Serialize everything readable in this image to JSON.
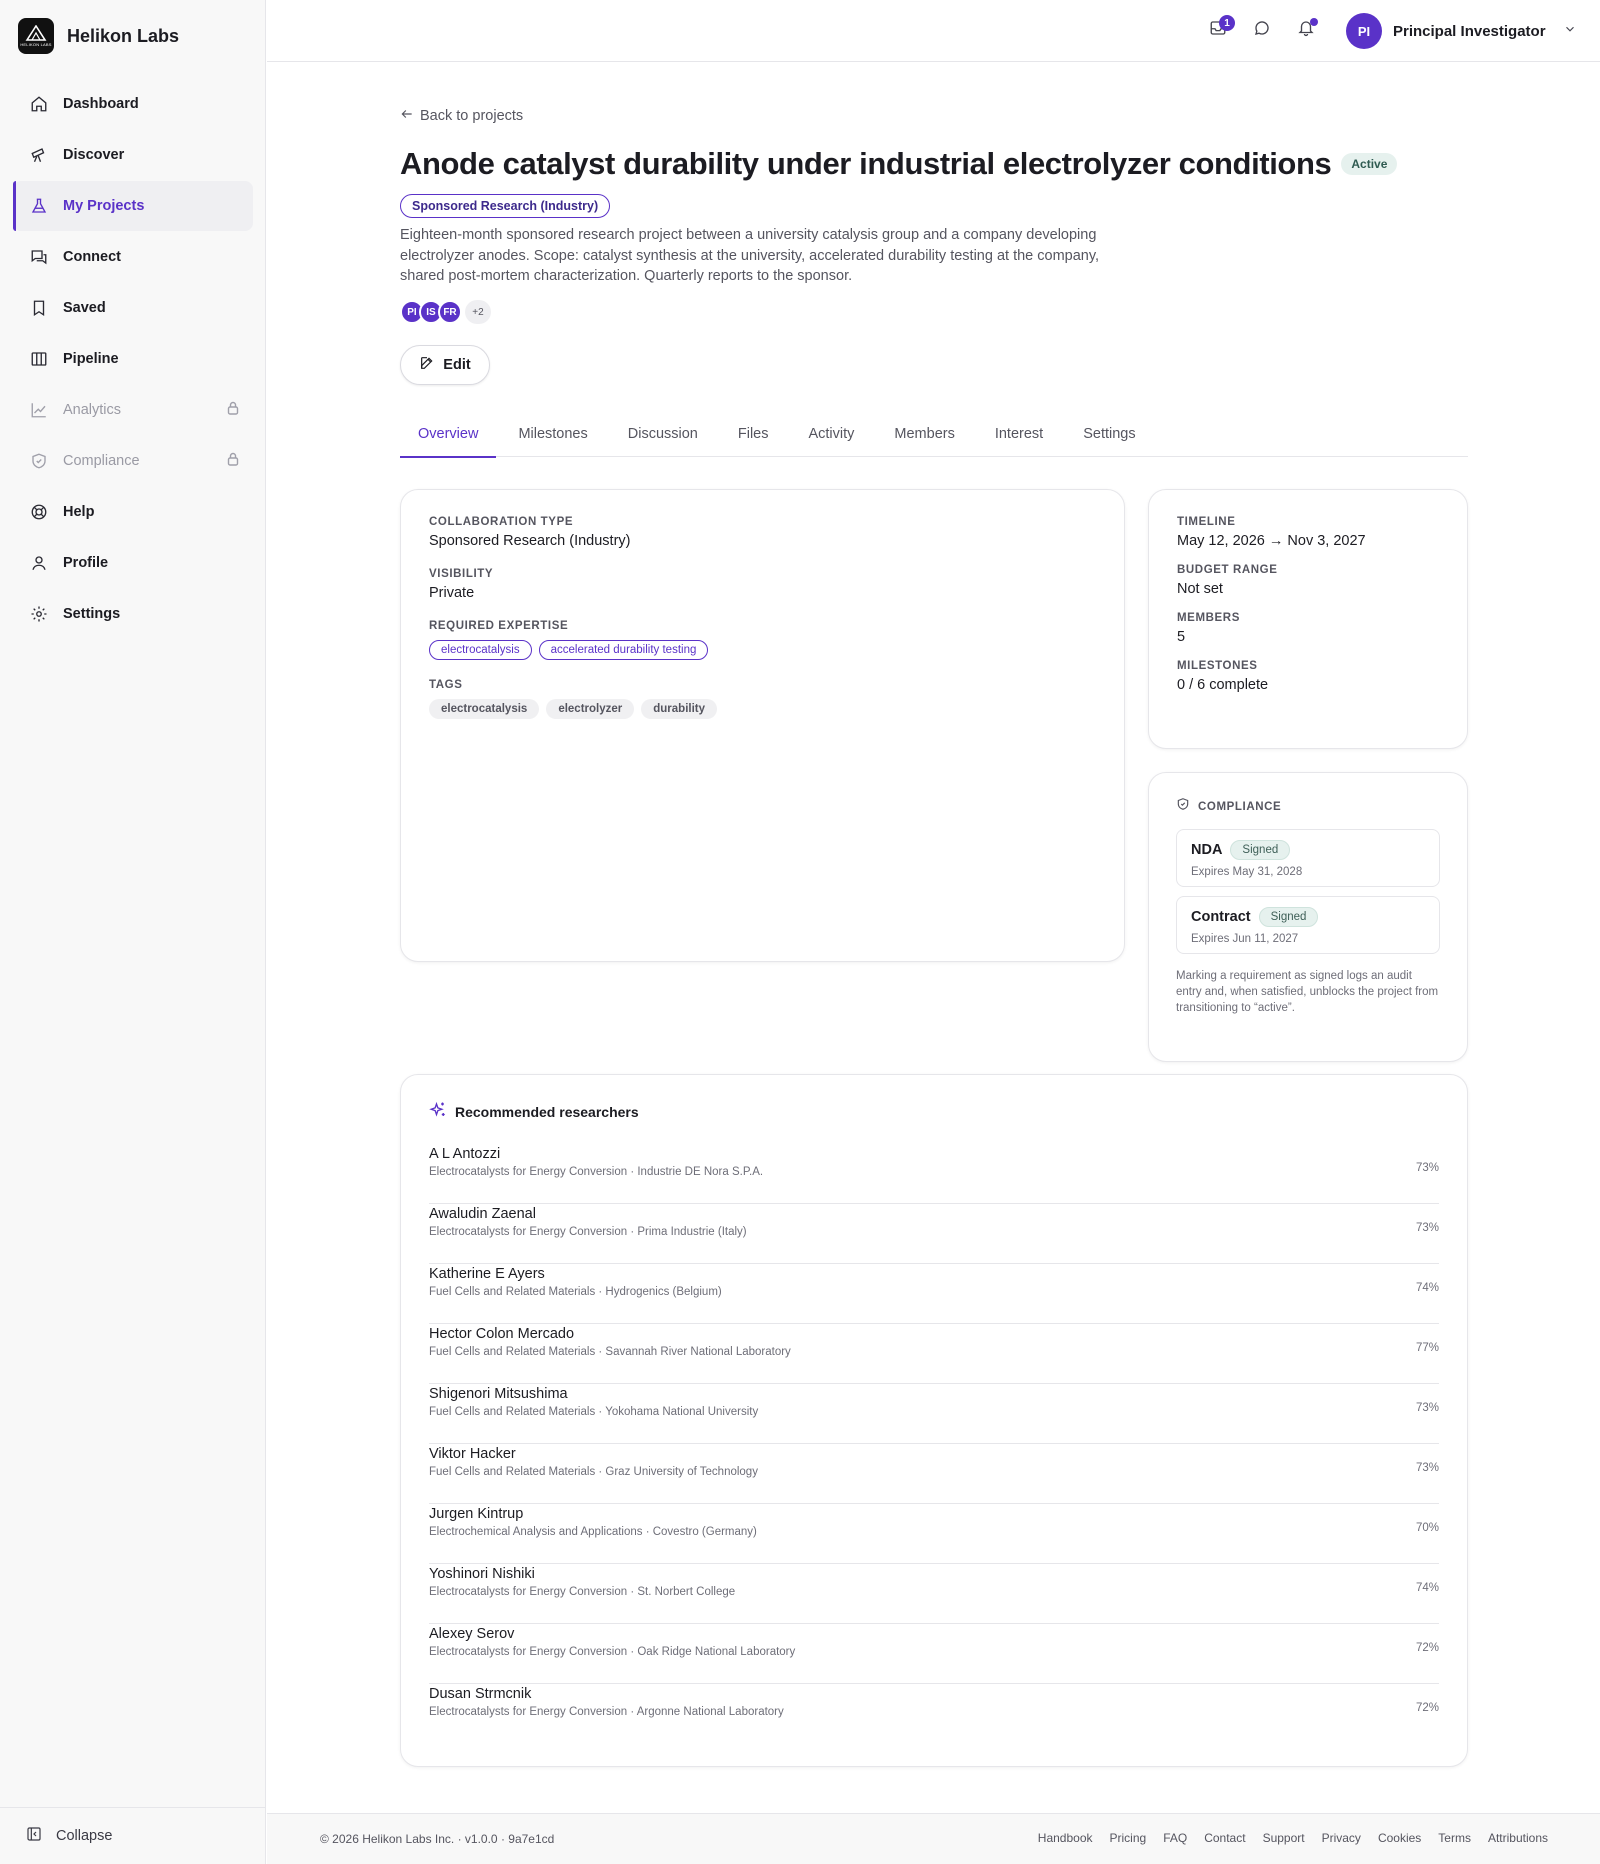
{
  "app": {
    "name": "Helikon Labs",
    "logo_text": "HELIKON LABS"
  },
  "sidebar": {
    "items": [
      {
        "label": "Dashboard",
        "icon": "home-icon",
        "state": "normal"
      },
      {
        "label": "Discover",
        "icon": "telescope-icon",
        "state": "normal"
      },
      {
        "label": "My Projects",
        "icon": "flask-icon",
        "state": "active"
      },
      {
        "label": "Connect",
        "icon": "chat-icon",
        "state": "normal"
      },
      {
        "label": "Saved",
        "icon": "bookmark-icon",
        "state": "normal"
      },
      {
        "label": "Pipeline",
        "icon": "columns-icon",
        "state": "normal"
      },
      {
        "label": "Analytics",
        "icon": "chart-icon",
        "state": "locked"
      },
      {
        "label": "Compliance",
        "icon": "shield-icon",
        "state": "locked"
      },
      {
        "label": "Help",
        "icon": "lifebuoy-icon",
        "state": "normal"
      },
      {
        "label": "Profile",
        "icon": "user-icon",
        "state": "normal"
      },
      {
        "label": "Settings",
        "icon": "gear-icon",
        "state": "normal"
      }
    ],
    "collapse_label": "Collapse"
  },
  "topbar": {
    "inbox_count": "1",
    "user_initials": "PI",
    "user_name": "Principal Investigator"
  },
  "project": {
    "back_label": "Back to projects",
    "title": "Anode catalyst durability under industrial electrolyzer conditions",
    "status": "Active",
    "type_chip": "Sponsored Research (Industry)",
    "description": "Eighteen-month sponsored research project between a university catalysis group and a company developing electrolyzer anodes. Scope: catalyst synthesis at the university, accelerated durability testing at the company, shared post-mortem characterization. Quarterly reports to the sponsor.",
    "member_avatars": [
      "PI",
      "IS",
      "FR"
    ],
    "more_members": "+2",
    "edit_label": "Edit"
  },
  "tabs": [
    "Overview",
    "Milestones",
    "Discussion",
    "Files",
    "Activity",
    "Members",
    "Interest",
    "Settings"
  ],
  "details": {
    "collab_type_label": "Collaboration type",
    "collab_type_value": "Sponsored Research (Industry)",
    "visibility_label": "Visibility",
    "visibility_value": "Private",
    "expertise_label": "Required expertise",
    "expertise": [
      "electrocatalysis",
      "accelerated durability testing"
    ],
    "tags_label": "Tags",
    "tags": [
      "electrocatalysis",
      "electrolyzer",
      "durability"
    ]
  },
  "summary": {
    "timeline_label": "Timeline",
    "timeline_value": "May 12, 2026 → Nov 3, 2027",
    "budget_label": "Budget range",
    "budget_value": "Not set",
    "members_label": "Members",
    "members_value": "5",
    "milestones_label": "Milestones",
    "milestones_value": "0 / 6 complete"
  },
  "compliance": {
    "heading": "Compliance",
    "items": [
      {
        "name": "NDA",
        "status": "Signed",
        "expires": "Expires May 31, 2028"
      },
      {
        "name": "Contract",
        "status": "Signed",
        "expires": "Expires Jun 11, 2027"
      }
    ],
    "note": "Marking a requirement as signed logs an audit entry and, when satisfied, unblocks the project from transitioning to “active”."
  },
  "recommended": {
    "heading": "Recommended researchers",
    "rows": [
      {
        "name": "A L Antozzi",
        "meta": "Electrocatalysts for Energy Conversion · Industrie DE Nora S.P.A.",
        "score": "73%"
      },
      {
        "name": "Awaludin Zaenal",
        "meta": "Electrocatalysts for Energy Conversion · Prima Industrie (Italy)",
        "score": "73%"
      },
      {
        "name": "Katherine E Ayers",
        "meta": "Fuel Cells and Related Materials · Hydrogenics (Belgium)",
        "score": "74%"
      },
      {
        "name": "Hector Colon Mercado",
        "meta": "Fuel Cells and Related Materials · Savannah River National Laboratory",
        "score": "77%"
      },
      {
        "name": "Shigenori Mitsushima",
        "meta": "Fuel Cells and Related Materials · Yokohama National University",
        "score": "73%"
      },
      {
        "name": "Viktor Hacker",
        "meta": "Fuel Cells and Related Materials · Graz University of Technology",
        "score": "73%"
      },
      {
        "name": "Jurgen Kintrup",
        "meta": "Electrochemical Analysis and Applications · Covestro (Germany)",
        "score": "70%"
      },
      {
        "name": "Yoshinori Nishiki",
        "meta": "Electrocatalysts for Energy Conversion · St. Norbert College",
        "score": "74%"
      },
      {
        "name": "Alexey Serov",
        "meta": "Electrocatalysts for Energy Conversion · Oak Ridge National Laboratory",
        "score": "72%"
      },
      {
        "name": "Dusan Strmcnik",
        "meta": "Electrocatalysts for Energy Conversion · Argonne National Laboratory",
        "score": "72%"
      }
    ]
  },
  "footer": {
    "copyright": "© 2026 Helikon Labs Inc. · v1.0.0 · 9a7e1cd",
    "links": [
      "Handbook",
      "Pricing",
      "FAQ",
      "Contact",
      "Support",
      "Privacy",
      "Cookies",
      "Terms",
      "Attributions"
    ]
  },
  "colors": {
    "accent": "#5a32c8",
    "signed_bg": "#e6f1ee",
    "sidebar_bg": "#f8f8f8"
  }
}
